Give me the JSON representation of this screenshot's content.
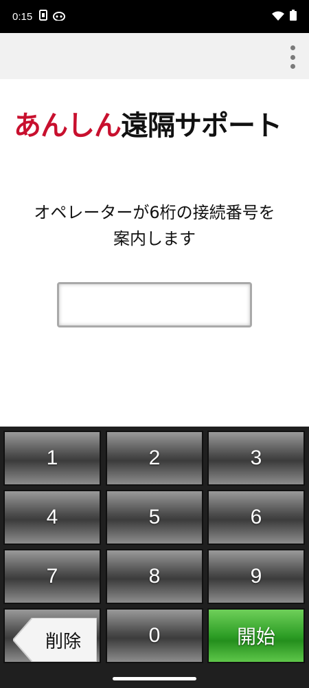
{
  "status_bar": {
    "time": "0:15",
    "left_icons": [
      "sim-card-icon",
      "android-icon"
    ],
    "right_icons": [
      "wifi-icon",
      "battery-icon"
    ]
  },
  "app_bar": {
    "menu_icon": "more-vert-icon"
  },
  "logo": {
    "part1": "あんしん",
    "part2": "遠隔サポート",
    "part1_color": "#c8102e",
    "part2_color": "#111111"
  },
  "instruction": {
    "line1": "オペレーターが6桁の接続番号を",
    "line2": "案内します"
  },
  "code_input": {
    "value": "",
    "placeholder": ""
  },
  "keypad": {
    "keys": [
      "1",
      "2",
      "3",
      "4",
      "5",
      "6",
      "7",
      "8",
      "9"
    ],
    "delete_label": "削除",
    "zero_label": "0",
    "start_label": "開始",
    "start_color": "#2e9e26"
  }
}
